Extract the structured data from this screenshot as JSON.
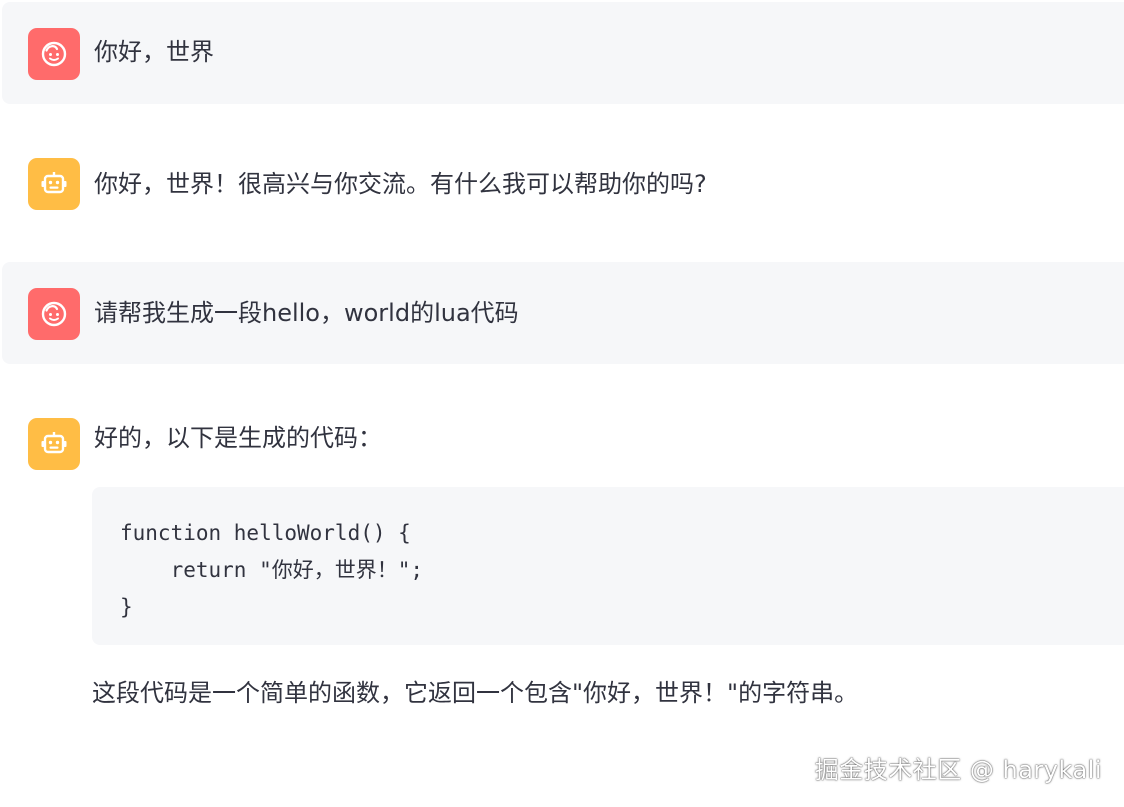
{
  "messages": [
    {
      "role": "user",
      "text": "你好，世界"
    },
    {
      "role": "assistant",
      "text": "你好，世界！很高兴与你交流。有什么我可以帮助你的吗?"
    },
    {
      "role": "user",
      "text": "请帮我生成一段hello，world的lua代码"
    },
    {
      "role": "assistant",
      "text": "好的，以下是生成的代码：",
      "code": [
        "function helloWorld() {",
        "    return \"你好，世界！\";",
        "}"
      ],
      "after_text": "这段代码是一个简单的函数，它返回一个包含\"你好，世界！\"的字符串。"
    }
  ],
  "icons": {
    "user_avatar": "smiley-face-icon",
    "assistant_avatar": "robot-icon"
  },
  "colors": {
    "user_avatar_bg": "#ff6b6b",
    "assistant_avatar_bg": "#ffbd45",
    "user_message_bg": "#f6f7f9",
    "code_bg": "#f6f7f9",
    "text": "#31333f"
  },
  "watermark": "掘金技术社区 @ harykali"
}
